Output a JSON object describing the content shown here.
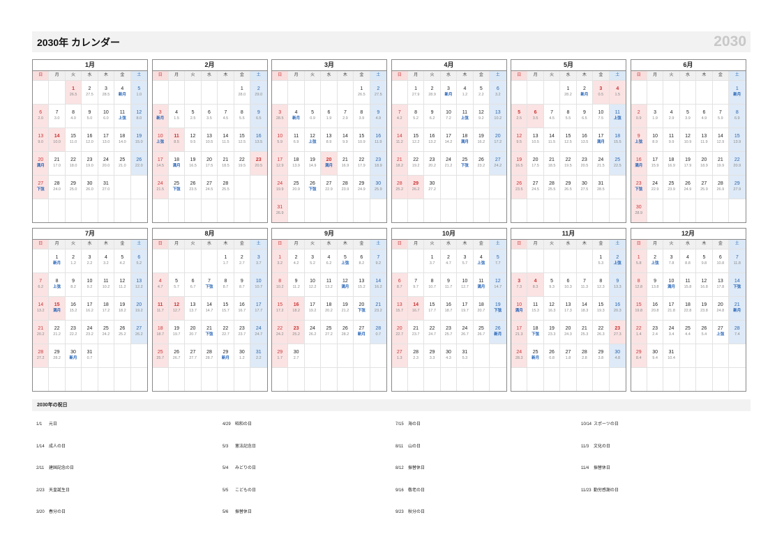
{
  "title": "2030年 カレンダー",
  "year_mark": "2030",
  "weekdays": [
    "日",
    "月",
    "火",
    "水",
    "木",
    "金",
    "土"
  ],
  "months": [
    {
      "name": "1月",
      "first_weekday": 2,
      "days": 31,
      "holidays": [
        1,
        14
      ],
      "ages": [
        "26.5",
        "27.5",
        "28.5",
        "新月",
        "1.0",
        "2.0",
        "3.0",
        "4.0",
        "5.0",
        "6.0",
        "上弦",
        "8.0",
        "9.0",
        "10.0",
        "11.0",
        "12.0",
        "13.0",
        "14.0",
        "15.0",
        "満月",
        "17.0",
        "18.0",
        "19.0",
        "20.0",
        "21.0",
        "22.0",
        "下弦",
        "24.0",
        "25.0",
        "26.0",
        "27.0"
      ]
    },
    {
      "name": "2月",
      "first_weekday": 5,
      "days": 28,
      "holidays": [
        11,
        23
      ],
      "ages": [
        "28.0",
        "29.0",
        "新月",
        "1.5",
        "2.5",
        "3.5",
        "4.5",
        "5.5",
        "6.5",
        "上弦",
        "8.5",
        "9.5",
        "10.5",
        "11.5",
        "12.5",
        "13.5",
        "14.5",
        "満月",
        "16.5",
        "17.5",
        "18.5",
        "19.5",
        "20.5",
        "21.5",
        "下弦",
        "23.5",
        "24.5",
        "25.5"
      ]
    },
    {
      "name": "3月",
      "first_weekday": 5,
      "days": 31,
      "holidays": [
        20
      ],
      "ages": [
        "26.5",
        "27.5",
        "28.5",
        "新月",
        "0.9",
        "1.9",
        "2.9",
        "3.9",
        "4.9",
        "5.9",
        "6.9",
        "上弦",
        "8.9",
        "9.9",
        "10.9",
        "11.9",
        "12.9",
        "13.9",
        "14.9",
        "満月",
        "16.9",
        "17.9",
        "18.9",
        "19.9",
        "20.9",
        "下弦",
        "22.9",
        "23.9",
        "24.9",
        "25.9",
        "26.9"
      ]
    },
    {
      "name": "4月",
      "first_weekday": 1,
      "days": 30,
      "holidays": [
        29
      ],
      "ages": [
        "27.9",
        "28.9",
        "新月",
        "1.2",
        "2.2",
        "3.2",
        "4.2",
        "5.2",
        "6.2",
        "7.2",
        "上弦",
        "9.2",
        "10.2",
        "11.2",
        "12.2",
        "13.2",
        "14.2",
        "満月",
        "16.2",
        "17.2",
        "18.2",
        "19.2",
        "20.2",
        "21.2",
        "下弦",
        "23.2",
        "24.2",
        "25.2",
        "26.2",
        "27.2"
      ]
    },
    {
      "name": "5月",
      "first_weekday": 3,
      "days": 31,
      "holidays": [
        3,
        4,
        5,
        6
      ],
      "ages": [
        "28.2",
        "新月",
        "0.5",
        "1.5",
        "2.5",
        "3.5",
        "4.5",
        "5.5",
        "6.5",
        "7.5",
        "上弦",
        "9.5",
        "10.5",
        "11.5",
        "12.5",
        "13.5",
        "満月",
        "15.5",
        "16.5",
        "17.5",
        "18.5",
        "19.5",
        "20.5",
        "21.5",
        "22.5",
        "23.5",
        "24.5",
        "25.5",
        "26.5",
        "27.5",
        "28.5"
      ]
    },
    {
      "name": "6月",
      "first_weekday": 6,
      "days": 30,
      "holidays": [],
      "ages": [
        "新月",
        "0.9",
        "1.9",
        "2.9",
        "3.9",
        "4.9",
        "5.9",
        "6.9",
        "上弦",
        "8.9",
        "9.9",
        "10.9",
        "11.9",
        "12.9",
        "13.9",
        "満月",
        "15.9",
        "16.9",
        "17.9",
        "18.9",
        "19.9",
        "20.9",
        "下弦",
        "22.9",
        "23.9",
        "24.9",
        "25.9",
        "26.9",
        "27.9",
        "28.9"
      ]
    },
    {
      "name": "7月",
      "first_weekday": 1,
      "days": 31,
      "holidays": [
        15
      ],
      "ages": [
        "新月",
        "1.2",
        "2.2",
        "3.2",
        "4.2",
        "5.2",
        "6.2",
        "上弦",
        "8.2",
        "9.2",
        "10.2",
        "11.2",
        "12.2",
        "13.2",
        "満月",
        "15.2",
        "16.2",
        "17.2",
        "18.2",
        "19.2",
        "20.2",
        "21.2",
        "22.2",
        "23.2",
        "24.2",
        "25.2",
        "26.2",
        "27.2",
        "28.2",
        "新月",
        "0.7"
      ]
    },
    {
      "name": "8月",
      "first_weekday": 4,
      "days": 31,
      "holidays": [
        11,
        12
      ],
      "ages": [
        "1.7",
        "2.7",
        "3.7",
        "4.7",
        "5.7",
        "6.7",
        "下弦",
        "8.7",
        "8.7",
        "10.7",
        "11.7",
        "12.7",
        "13.7",
        "14.7",
        "15.7",
        "16.7",
        "17.7",
        "18.7",
        "19.7",
        "20.7",
        "下弦",
        "22.7",
        "23.7",
        "24.7",
        "25.7",
        "26.7",
        "27.7",
        "28.7",
        "新月",
        "1.2",
        "2.2"
      ]
    },
    {
      "name": "9月",
      "first_weekday": 0,
      "days": 30,
      "holidays": [
        16,
        23
      ],
      "ages": [
        "3.2",
        "4.2",
        "5.2",
        "6.2",
        "上弦",
        "8.2",
        "9.2",
        "10.2",
        "11.2",
        "12.2",
        "13.2",
        "満月",
        "15.2",
        "16.2",
        "17.2",
        "18.2",
        "19.2",
        "20.2",
        "21.2",
        "下弦",
        "23.2",
        "24.2",
        "25.2",
        "26.2",
        "27.2",
        "28.2",
        "新月",
        "0.7",
        "1.7",
        "2.7"
      ]
    },
    {
      "name": "10月",
      "first_weekday": 2,
      "days": 31,
      "holidays": [
        14
      ],
      "ages": [
        "3.7",
        "4.7",
        "5.7",
        "上弦",
        "7.7",
        "8.7",
        "9.7",
        "10.7",
        "11.7",
        "12.7",
        "満月",
        "14.7",
        "15.7",
        "16.7",
        "17.7",
        "18.7",
        "19.7",
        "20.7",
        "下弦",
        "22.7",
        "23.7",
        "24.7",
        "25.7",
        "26.7",
        "26.7",
        "新月",
        "1.3",
        "2.3",
        "3.3",
        "4.3",
        "5.3"
      ]
    },
    {
      "name": "11月",
      "first_weekday": 5,
      "days": 30,
      "holidays": [
        3,
        4,
        23
      ],
      "ages": [
        "5.3",
        "上弦",
        "7.3",
        "8.3",
        "9.3",
        "10.3",
        "11.3",
        "12.3",
        "13.3",
        "満月",
        "15.3",
        "16.3",
        "17.3",
        "18.3",
        "19.3",
        "20.3",
        "21.3",
        "下弦",
        "23.3",
        "24.3",
        "25.3",
        "26.3",
        "27.3",
        "28.3",
        "新月",
        "0.8",
        "1.8",
        "2.8",
        "3.8",
        "4.8"
      ]
    },
    {
      "name": "12月",
      "first_weekday": 0,
      "days": 31,
      "holidays": [],
      "ages": [
        "5.8",
        "上弦",
        "7.8",
        "8.8",
        "9.8",
        "10.8",
        "11.8",
        "12.8",
        "13.8",
        "満月",
        "15.8",
        "16.8",
        "17.8",
        "下弦",
        "19.8",
        "20.8",
        "21.8",
        "22.8",
        "23.8",
        "24.8",
        "新月",
        "1.4",
        "2.4",
        "3.4",
        "4.4",
        "5.4",
        "上弦",
        "7.4",
        "8.4",
        "9.4",
        "10.4"
      ]
    }
  ],
  "holidays_title": "2030年の祝日",
  "holidays": [
    {
      "date": "1/1",
      "name": "元日"
    },
    {
      "date": "1/14",
      "name": "成人の日"
    },
    {
      "date": "2/11",
      "name": "建国記念の日"
    },
    {
      "date": "2/23",
      "name": "天皇誕生日"
    },
    {
      "date": "3/20",
      "name": "春分の日"
    },
    {
      "date": "4/29",
      "name": "昭和の日"
    },
    {
      "date": "5/3",
      "name": "憲法記念日"
    },
    {
      "date": "5/4",
      "name": "みどりの日"
    },
    {
      "date": "5/5",
      "name": "こどもの日"
    },
    {
      "date": "5/6",
      "name": "振替休日"
    },
    {
      "date": "7/15",
      "name": "海の日"
    },
    {
      "date": "8/11",
      "name": "山の日"
    },
    {
      "date": "8/12",
      "name": "振替休日"
    },
    {
      "date": "9/16",
      "name": "敬老の日"
    },
    {
      "date": "9/23",
      "name": "秋分の日"
    },
    {
      "date": "10/14",
      "name": "スポーツの日"
    },
    {
      "date": "11/3",
      "name": "文化の日"
    },
    {
      "date": "11/4",
      "name": "振替休日"
    },
    {
      "date": "11/23",
      "name": "勤労感謝の日"
    }
  ]
}
